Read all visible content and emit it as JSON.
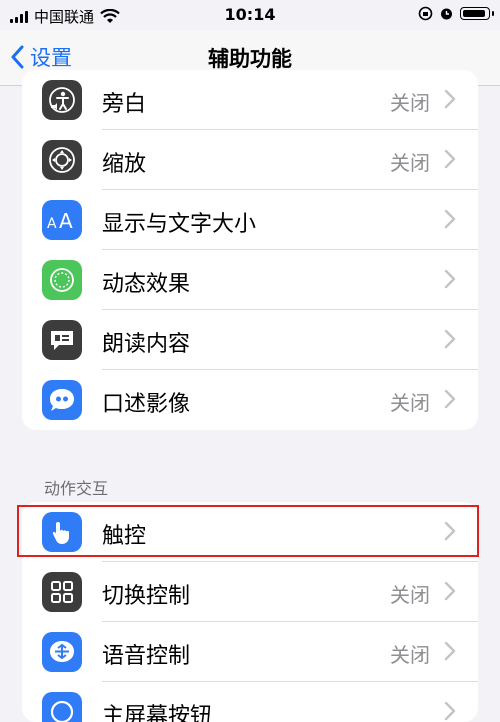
{
  "status_bar": {
    "carrier": "中国联通",
    "time": "10:14"
  },
  "nav": {
    "back_label": "设置",
    "title": "辅助功能"
  },
  "group1": [
    {
      "label": "旁白",
      "value": "关闭",
      "icon": "voiceover-icon",
      "color": "#3c3c3c"
    },
    {
      "label": "缩放",
      "value": "关闭",
      "icon": "zoom-icon",
      "color": "#3c3c3c"
    },
    {
      "label": "显示与文字大小",
      "value": "",
      "icon": "text-size-icon",
      "color": "#2f7cf6"
    },
    {
      "label": "动态效果",
      "value": "",
      "icon": "motion-icon",
      "color": "#4cc55a"
    },
    {
      "label": "朗读内容",
      "value": "",
      "icon": "spoken-content-icon",
      "color": "#3c3c3c"
    },
    {
      "label": "口述影像",
      "value": "关闭",
      "icon": "audio-description-icon",
      "color": "#2f7cf6"
    }
  ],
  "section": {
    "header": "动作交互"
  },
  "group2": [
    {
      "label": "触控",
      "value": "",
      "icon": "touch-icon",
      "color": "#2f7cf6"
    },
    {
      "label": "切换控制",
      "value": "关闭",
      "icon": "switch-control-icon",
      "color": "#3c3c3c"
    },
    {
      "label": "语音控制",
      "value": "关闭",
      "icon": "voice-control-icon",
      "color": "#2f7cf6"
    },
    {
      "label": "主屏幕按钮",
      "value": "",
      "icon": "home-button-icon",
      "color": "#2f7cf6"
    }
  ]
}
